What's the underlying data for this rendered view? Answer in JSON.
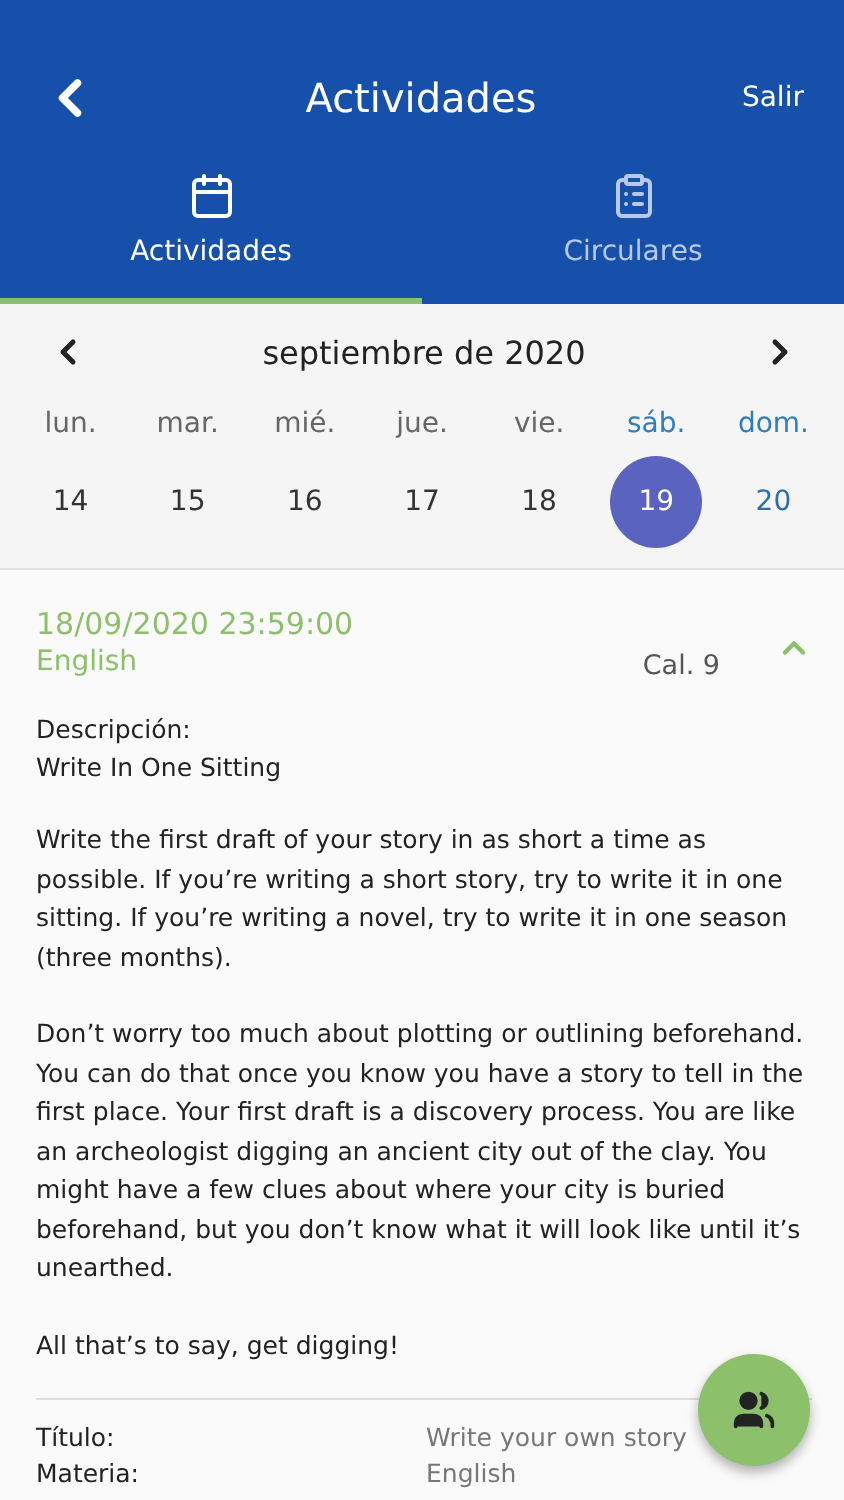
{
  "header": {
    "title": "Actividades",
    "action": "Salir"
  },
  "tabs": [
    {
      "label": "Actividades",
      "selected": true
    },
    {
      "label": "Circulares",
      "selected": false
    }
  ],
  "calendar": {
    "month": "septiembre de 2020",
    "weekdays": [
      {
        "label": "lun.",
        "weekend": false
      },
      {
        "label": "mar.",
        "weekend": false
      },
      {
        "label": "mié.",
        "weekend": false
      },
      {
        "label": "jue.",
        "weekend": false
      },
      {
        "label": "vie.",
        "weekend": false
      },
      {
        "label": "sáb.",
        "weekend": true
      },
      {
        "label": "dom.",
        "weekend": true
      }
    ],
    "dates": [
      {
        "label": "14",
        "weekend": false,
        "selected": false
      },
      {
        "label": "15",
        "weekend": false,
        "selected": false
      },
      {
        "label": "16",
        "weekend": false,
        "selected": false
      },
      {
        "label": "17",
        "weekend": false,
        "selected": false
      },
      {
        "label": "18",
        "weekend": false,
        "selected": false
      },
      {
        "label": "19",
        "weekend": true,
        "selected": true
      },
      {
        "label": "20",
        "weekend": true,
        "selected": false
      }
    ]
  },
  "activity": {
    "due": "18/09/2020 23:59:00",
    "subject": "English",
    "grade": "Cal. 9",
    "expanded": true,
    "description_label": "Descripción:",
    "description_title": "Write In One Sitting",
    "paragraphs": [
      "Write the first draft of your story in as short a time as possible. If you’re writing a short story, try to write it in one sitting. If you’re writing a novel, try to write it in one season (three months).",
      "Don’t worry too much about plotting or outlining beforehand. You can do that once you know you have a story to tell in the first place. Your first draft is a discovery process. You are like an archeologist digging an ancient city out of the clay. You might have a few clues about where your city is buried beforehand, but you don’t know what it will look like until it’s unearthed.",
      "All that’s to say, get digging!"
    ],
    "details": [
      {
        "label": "Título:",
        "value": "Write your own story"
      },
      {
        "label": "Materia:",
        "value": "English"
      }
    ]
  }
}
